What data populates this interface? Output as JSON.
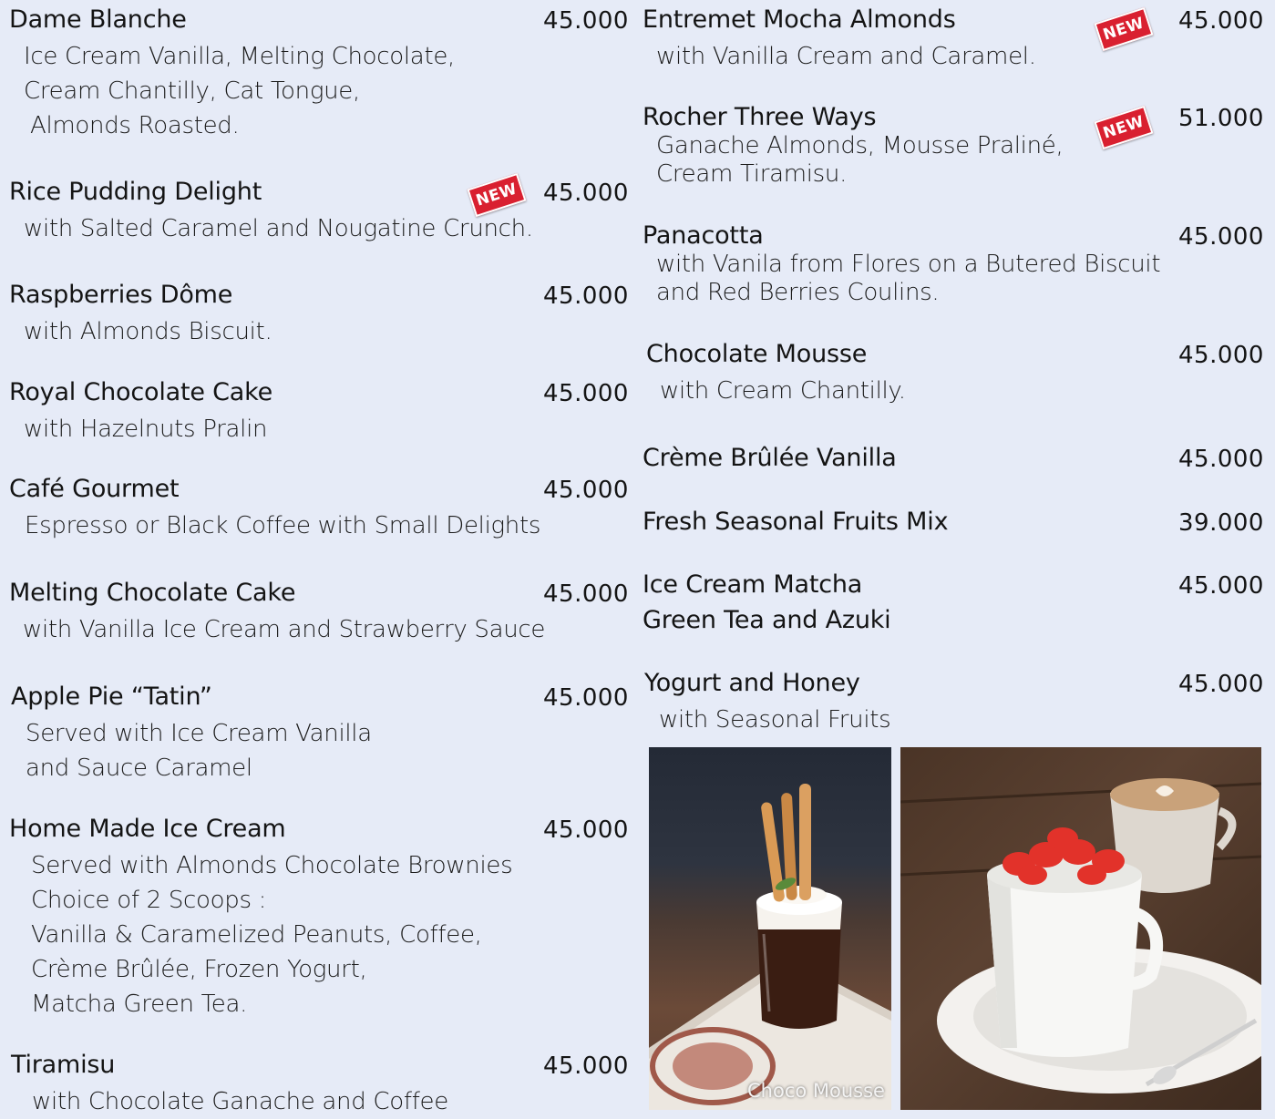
{
  "left_items": [
    {
      "name": "Dame Blanche",
      "price": "45.000",
      "desc": [
        "Ice Cream Vanilla, Melting Chocolate,",
        "Cream Chantilly, Cat Tongue,",
        "Almonds Roasted."
      ]
    },
    {
      "name": "Rice Pudding Delight",
      "price": "45.000",
      "badge": "NEW",
      "desc": [
        "with Salted Caramel and Nougatine Crunch."
      ]
    },
    {
      "name": "Raspberries Dôme",
      "price": "45.000",
      "desc": [
        "with Almonds Biscuit."
      ]
    },
    {
      "name": "Royal Chocolate Cake",
      "price": "45.000",
      "desc": [
        "with Hazelnuts Pralin"
      ]
    },
    {
      "name": "Café Gourmet",
      "price": "45.000",
      "desc": [
        "Espresso or Black Coffee with Small Delights"
      ]
    },
    {
      "name": "Melting Chocolate Cake",
      "price": "45.000",
      "desc": [
        "with Vanilla Ice Cream and Strawberry Sauce"
      ]
    },
    {
      "name": "Apple Pie “Tatin”",
      "price": "45.000",
      "desc": [
        "Served with Ice Cream Vanilla",
        "and Sauce Caramel"
      ]
    },
    {
      "name": "Home Made Ice Cream",
      "price": "45.000",
      "desc": [
        "Served with Almonds Chocolate Brownies",
        "Choice of 2 Scoops :",
        "Vanilla & Caramelized Peanuts, Coffee,",
        "Crème Brûlée,  Frozen Yogurt,",
        "Matcha Green Tea."
      ]
    },
    {
      "name": "Tiramisu",
      "price": "45.000",
      "desc": [
        "with Chocolate Ganache and Coffee"
      ]
    }
  ],
  "right_items": [
    {
      "name": "Entremet Mocha Almonds",
      "price": "45.000",
      "badge": "NEW",
      "desc": [
        "with Vanilla Cream and Caramel."
      ]
    },
    {
      "name": "Rocher Three Ways",
      "price": "51.000",
      "badge": "NEW",
      "desc": [
        "Ganache Almonds, Mousse Praliné,",
        "Cream Tiramisu."
      ]
    },
    {
      "name": "Panacotta",
      "price": "45.000",
      "desc": [
        "with Vanila from Flores on a Butered Biscuit",
        "and Red Berries Coulins."
      ]
    },
    {
      "name": "Chocolate Mousse",
      "price": "45.000",
      "desc": [
        "with Cream Chantilly."
      ]
    },
    {
      "name": "Crème Brûlée Vanilla",
      "price": "45.000",
      "desc": []
    },
    {
      "name": "Fresh Seasonal Fruits Mix",
      "price": "39.000",
      "desc": []
    },
    {
      "name": "Ice Cream Matcha",
      "name2": "Green Tea and Azuki",
      "price": "45.000",
      "desc": []
    },
    {
      "name": "Yogurt and Honey",
      "price": "45.000",
      "desc": [
        "with Seasonal Fruits"
      ]
    }
  ],
  "photos": {
    "mousse_caption": "Choco Mousse"
  },
  "colors": {
    "background": "#e6ebf7",
    "badge": "#d92030"
  }
}
